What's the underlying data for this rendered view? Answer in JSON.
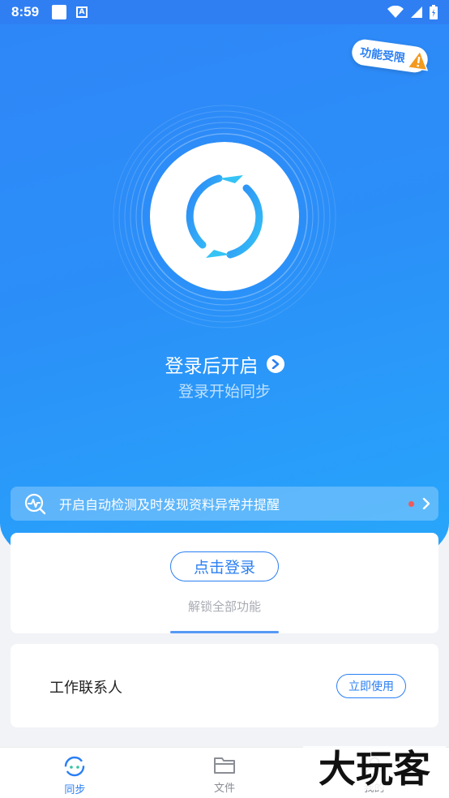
{
  "status_bar": {
    "time": "8:59",
    "a_badge": "A"
  },
  "hero": {
    "limited_badge": "功能受限",
    "login_then_open": "登录后开启",
    "login_start_sync": "登录开始同步"
  },
  "auto_banner": {
    "text": "开启自动检测及时发现资料异常并提醒"
  },
  "login_card": {
    "login_button": "点击登录",
    "unlock_text": "解锁全部功能"
  },
  "contacts_card": {
    "label": "工作联系人",
    "use_now": "立即使用"
  },
  "bottom_nav": {
    "items": [
      {
        "label": "同步",
        "icon": "sync-icon",
        "active": true
      },
      {
        "label": "文件",
        "icon": "folder-icon",
        "active": false
      },
      {
        "label": "我的",
        "icon": "user-icon",
        "active": false
      }
    ]
  },
  "watermark": {
    "text": "大玩客"
  },
  "colors": {
    "accent": "#2a7ff3",
    "hero_start": "#2f86f7",
    "hero_end": "#27a9fb",
    "warning": "#f39a1e",
    "dot": "#f05a5a"
  }
}
